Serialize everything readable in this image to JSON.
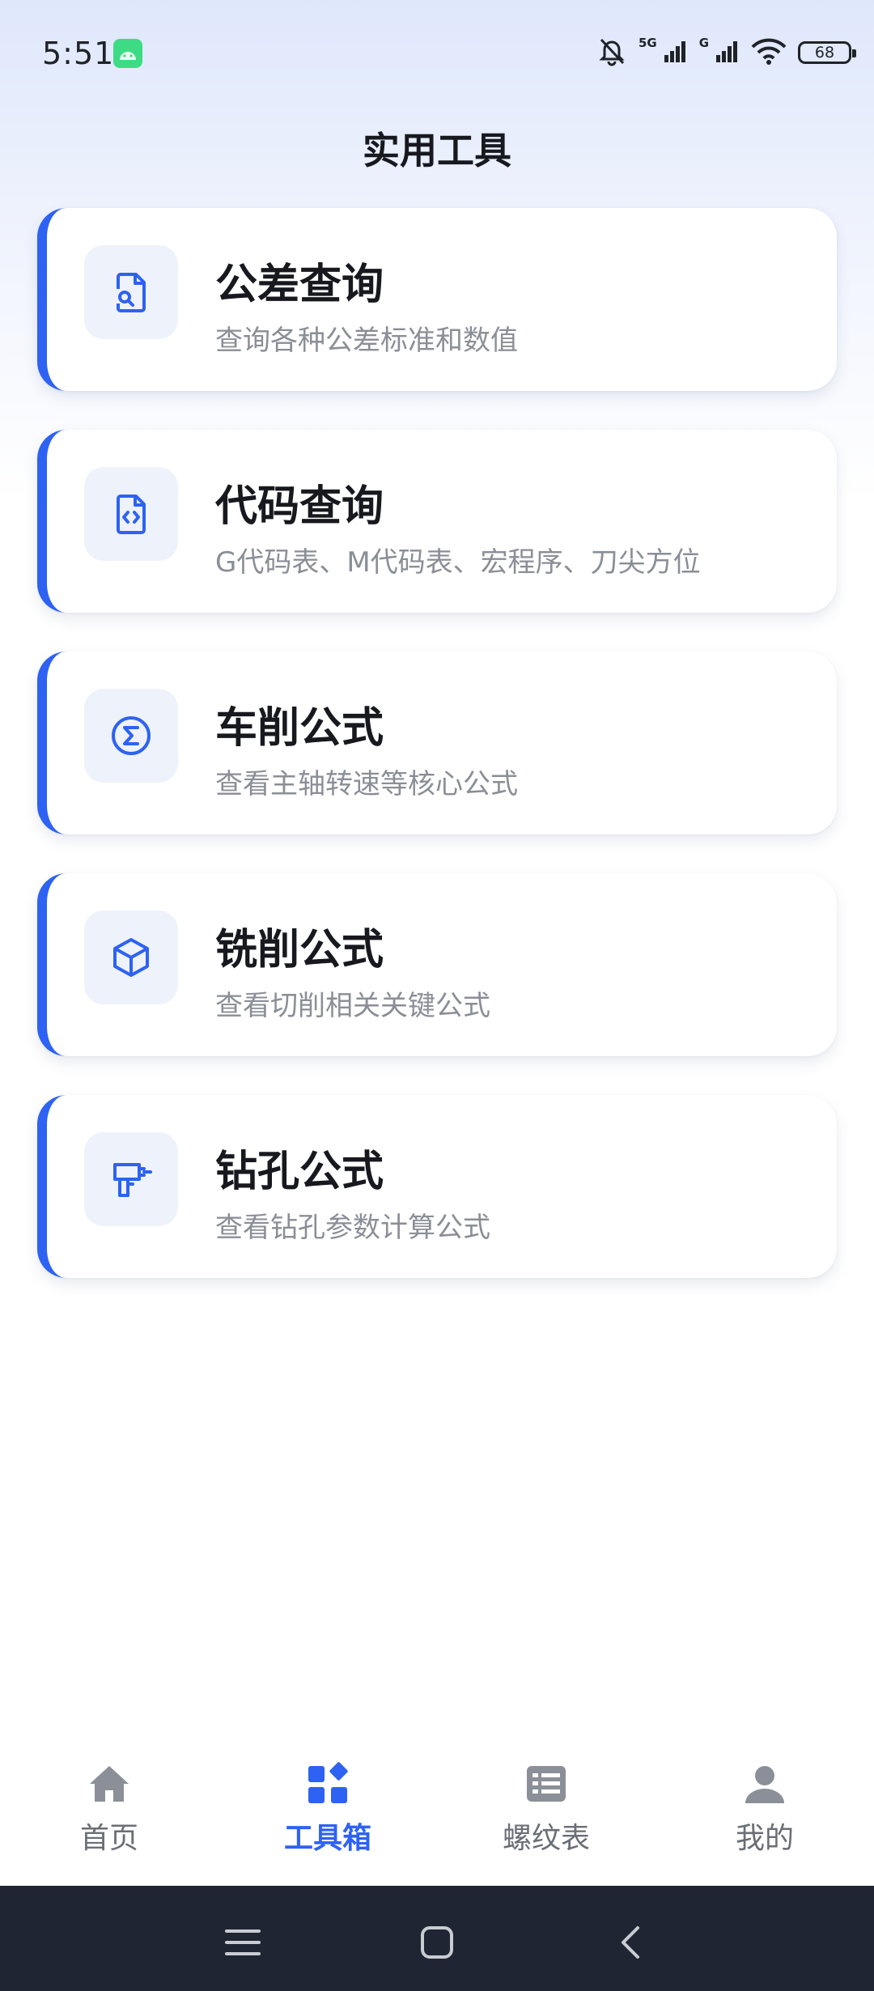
{
  "status": {
    "time": "5:51",
    "network1": "5G",
    "network2": "G",
    "battery": "68"
  },
  "header": {
    "title": "实用工具"
  },
  "tools": [
    {
      "title": "公差查询",
      "subtitle": "查询各种公差标准和数值",
      "icon": "search-document-icon"
    },
    {
      "title": "代码查询",
      "subtitle": "G代码表、M代码表、宏程序、刀尖方位",
      "icon": "code-file-icon"
    },
    {
      "title": "车削公式",
      "subtitle": "查看主轴转速等核心公式",
      "icon": "sigma-icon"
    },
    {
      "title": "铣削公式",
      "subtitle": "查看切削相关关键公式",
      "icon": "cube-icon"
    },
    {
      "title": "钻孔公式",
      "subtitle": "查看钻孔参数计算公式",
      "icon": "drill-icon"
    }
  ],
  "bottom_nav": [
    {
      "label": "首页",
      "icon": "home-icon",
      "active": false
    },
    {
      "label": "工具箱",
      "icon": "toolbox-icon",
      "active": true
    },
    {
      "label": "螺纹表",
      "icon": "table-icon",
      "active": false
    },
    {
      "label": "我的",
      "icon": "user-icon",
      "active": false
    }
  ],
  "colors": {
    "accent": "#2d62f2",
    "inactive": "#6a6e76",
    "subtitle": "#8a8e96",
    "system_bar": "#1f2532"
  }
}
